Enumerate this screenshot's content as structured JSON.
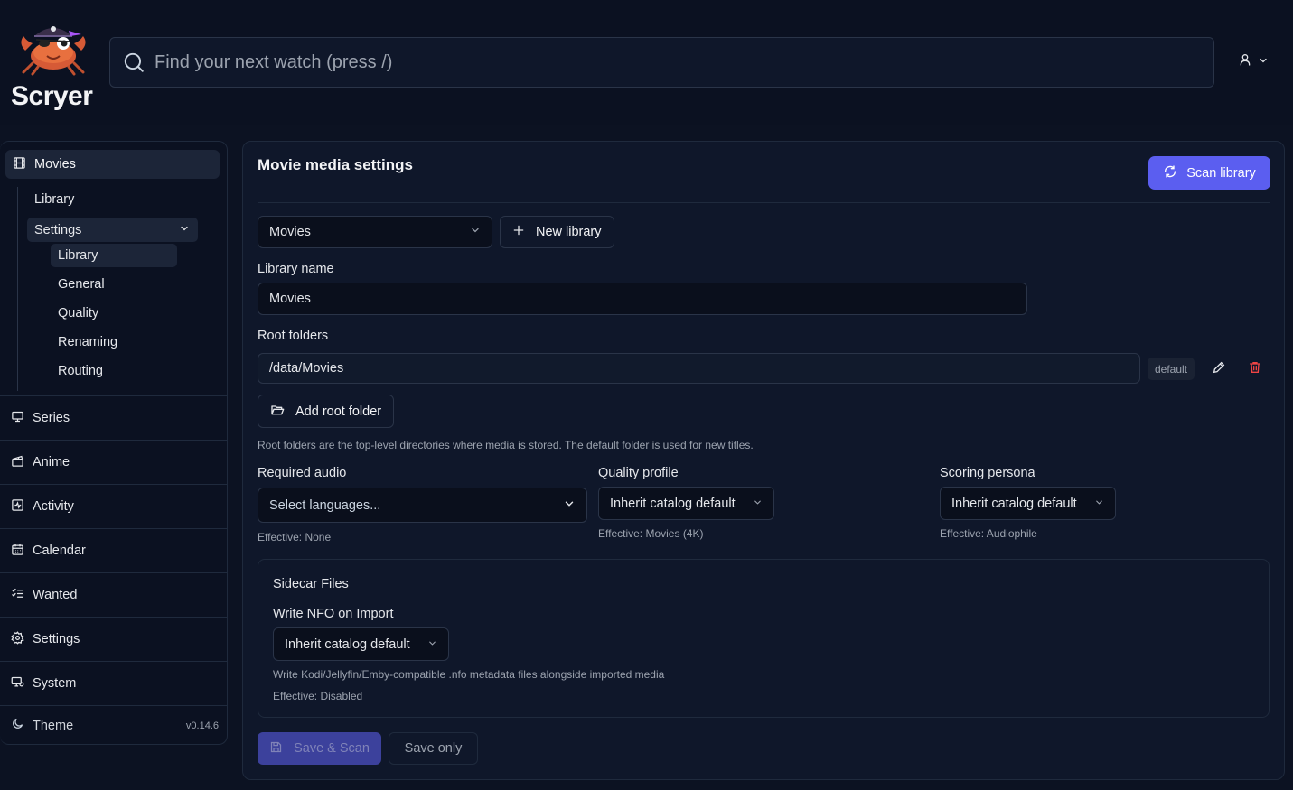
{
  "app": {
    "name": "Scryer",
    "version": "v0.14.6"
  },
  "search": {
    "placeholder": "Find your next watch (press /)"
  },
  "sidebar": {
    "movies_label": "Movies",
    "movies_sub": {
      "library": "Library",
      "settings": "Settings",
      "settings_sub": [
        "Library",
        "General",
        "Quality",
        "Renaming",
        "Routing"
      ]
    },
    "items": [
      {
        "label": "Series",
        "icon": "monitor-icon"
      },
      {
        "label": "Anime",
        "icon": "clapperboard-icon"
      },
      {
        "label": "Activity",
        "icon": "activity-icon"
      },
      {
        "label": "Calendar",
        "icon": "calendar-icon"
      },
      {
        "label": "Wanted",
        "icon": "list-checks-icon"
      },
      {
        "label": "Settings",
        "icon": "gear-icon"
      },
      {
        "label": "System",
        "icon": "system-icon"
      }
    ],
    "theme_label": "Theme"
  },
  "main": {
    "title": "Movie media settings",
    "scan_button": "Scan library",
    "library_select": "Movies",
    "new_library_button": "New library",
    "library_name_label": "Library name",
    "library_name_value": "Movies",
    "root_folders_label": "Root folders",
    "root_folder_path": "/data/Movies",
    "root_folder_badge": "default",
    "add_root_folder_button": "Add root folder",
    "root_folders_help": "Root folders are the top-level directories where media is stored. The default folder is used for new titles.",
    "required_audio": {
      "label": "Required audio",
      "placeholder": "Select languages...",
      "effective": "Effective: None"
    },
    "quality_profile": {
      "label": "Quality profile",
      "value": "Inherit catalog default",
      "effective": "Effective: Movies (4K)"
    },
    "scoring_persona": {
      "label": "Scoring persona",
      "value": "Inherit catalog default",
      "effective": "Effective: Audiophile"
    },
    "sidecar": {
      "title": "Sidecar Files",
      "nfo_label": "Write NFO on Import",
      "nfo_value": "Inherit catalog default",
      "nfo_help": "Write Kodi/Jellyfin/Emby-compatible .nfo metadata files alongside imported media",
      "nfo_effective": "Effective: Disabled"
    },
    "save_scan_button": "Save & Scan",
    "save_only_button": "Save only"
  },
  "colors": {
    "accent": "#5b5ef0",
    "background": "#0c1222",
    "panel": "#0f172a",
    "danger": "#ef4444"
  }
}
